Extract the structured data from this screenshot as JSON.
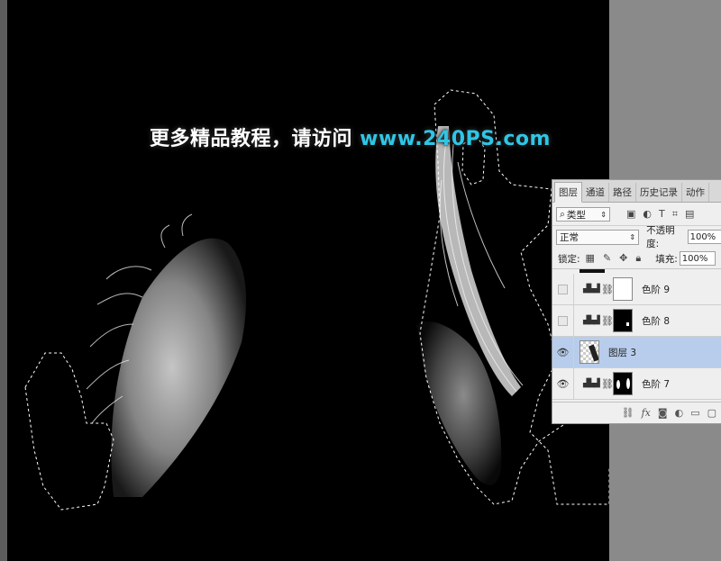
{
  "watermark": {
    "text": "更多精品教程，请访问 ",
    "url": "www.240PS.com"
  },
  "panel": {
    "tabs": [
      "图层",
      "通道",
      "路径",
      "历史记录",
      "动作"
    ],
    "filter": {
      "label": "类型",
      "search_icon": "search-icon"
    },
    "blend_mode": "正常",
    "opacity": {
      "label": "不透明度:",
      "value": "100%"
    },
    "lock": {
      "label": "锁定:"
    },
    "fill": {
      "label": "填充:",
      "value": "100%"
    },
    "layers": [
      {
        "name": "色阶 9",
        "visible": false,
        "type": "adjustment"
      },
      {
        "name": "色阶 8",
        "visible": false,
        "type": "adjustment"
      },
      {
        "name": "图层 3",
        "visible": true,
        "type": "pixel",
        "selected": true
      },
      {
        "name": "色阶 7",
        "visible": true,
        "type": "adjustment"
      }
    ],
    "footer_icons": [
      "link-icon",
      "fx-icon",
      "mask-icon",
      "adjustment-icon",
      "folder-icon",
      "new-layer-icon"
    ]
  },
  "colors": {
    "canvas": "#000000",
    "pasteboard": "#8a8a8a",
    "selected_layer": "#b8cdeb",
    "url": "#2ec6e6"
  }
}
